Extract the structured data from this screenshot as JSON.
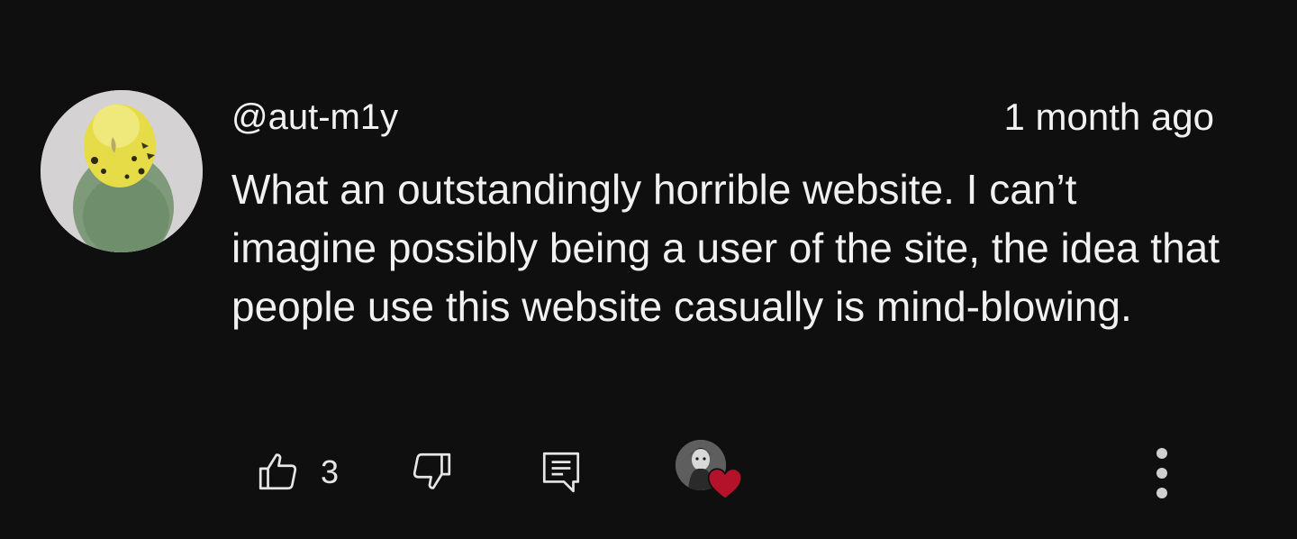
{
  "comment": {
    "author": "@aut-m1y",
    "timestamp": "1 month ago",
    "text": "What an outstandingly horrible website. I can’t imagine possibly being a user of the site, the idea that people use this website casually is mind-blowing.",
    "avatar_icon": "parakeet-avatar",
    "actions": {
      "like_icon": "thumbs-up-icon",
      "like_count": "3",
      "dislike_icon": "thumbs-down-icon",
      "reply_icon": "reply-icon",
      "creator_heart_icon": "creator-heart-icon",
      "more_icon": "more-vertical-icon"
    },
    "colors": {
      "background": "#0f0f0f",
      "text": "#f1f1f1",
      "heart": "#b3122a"
    }
  }
}
